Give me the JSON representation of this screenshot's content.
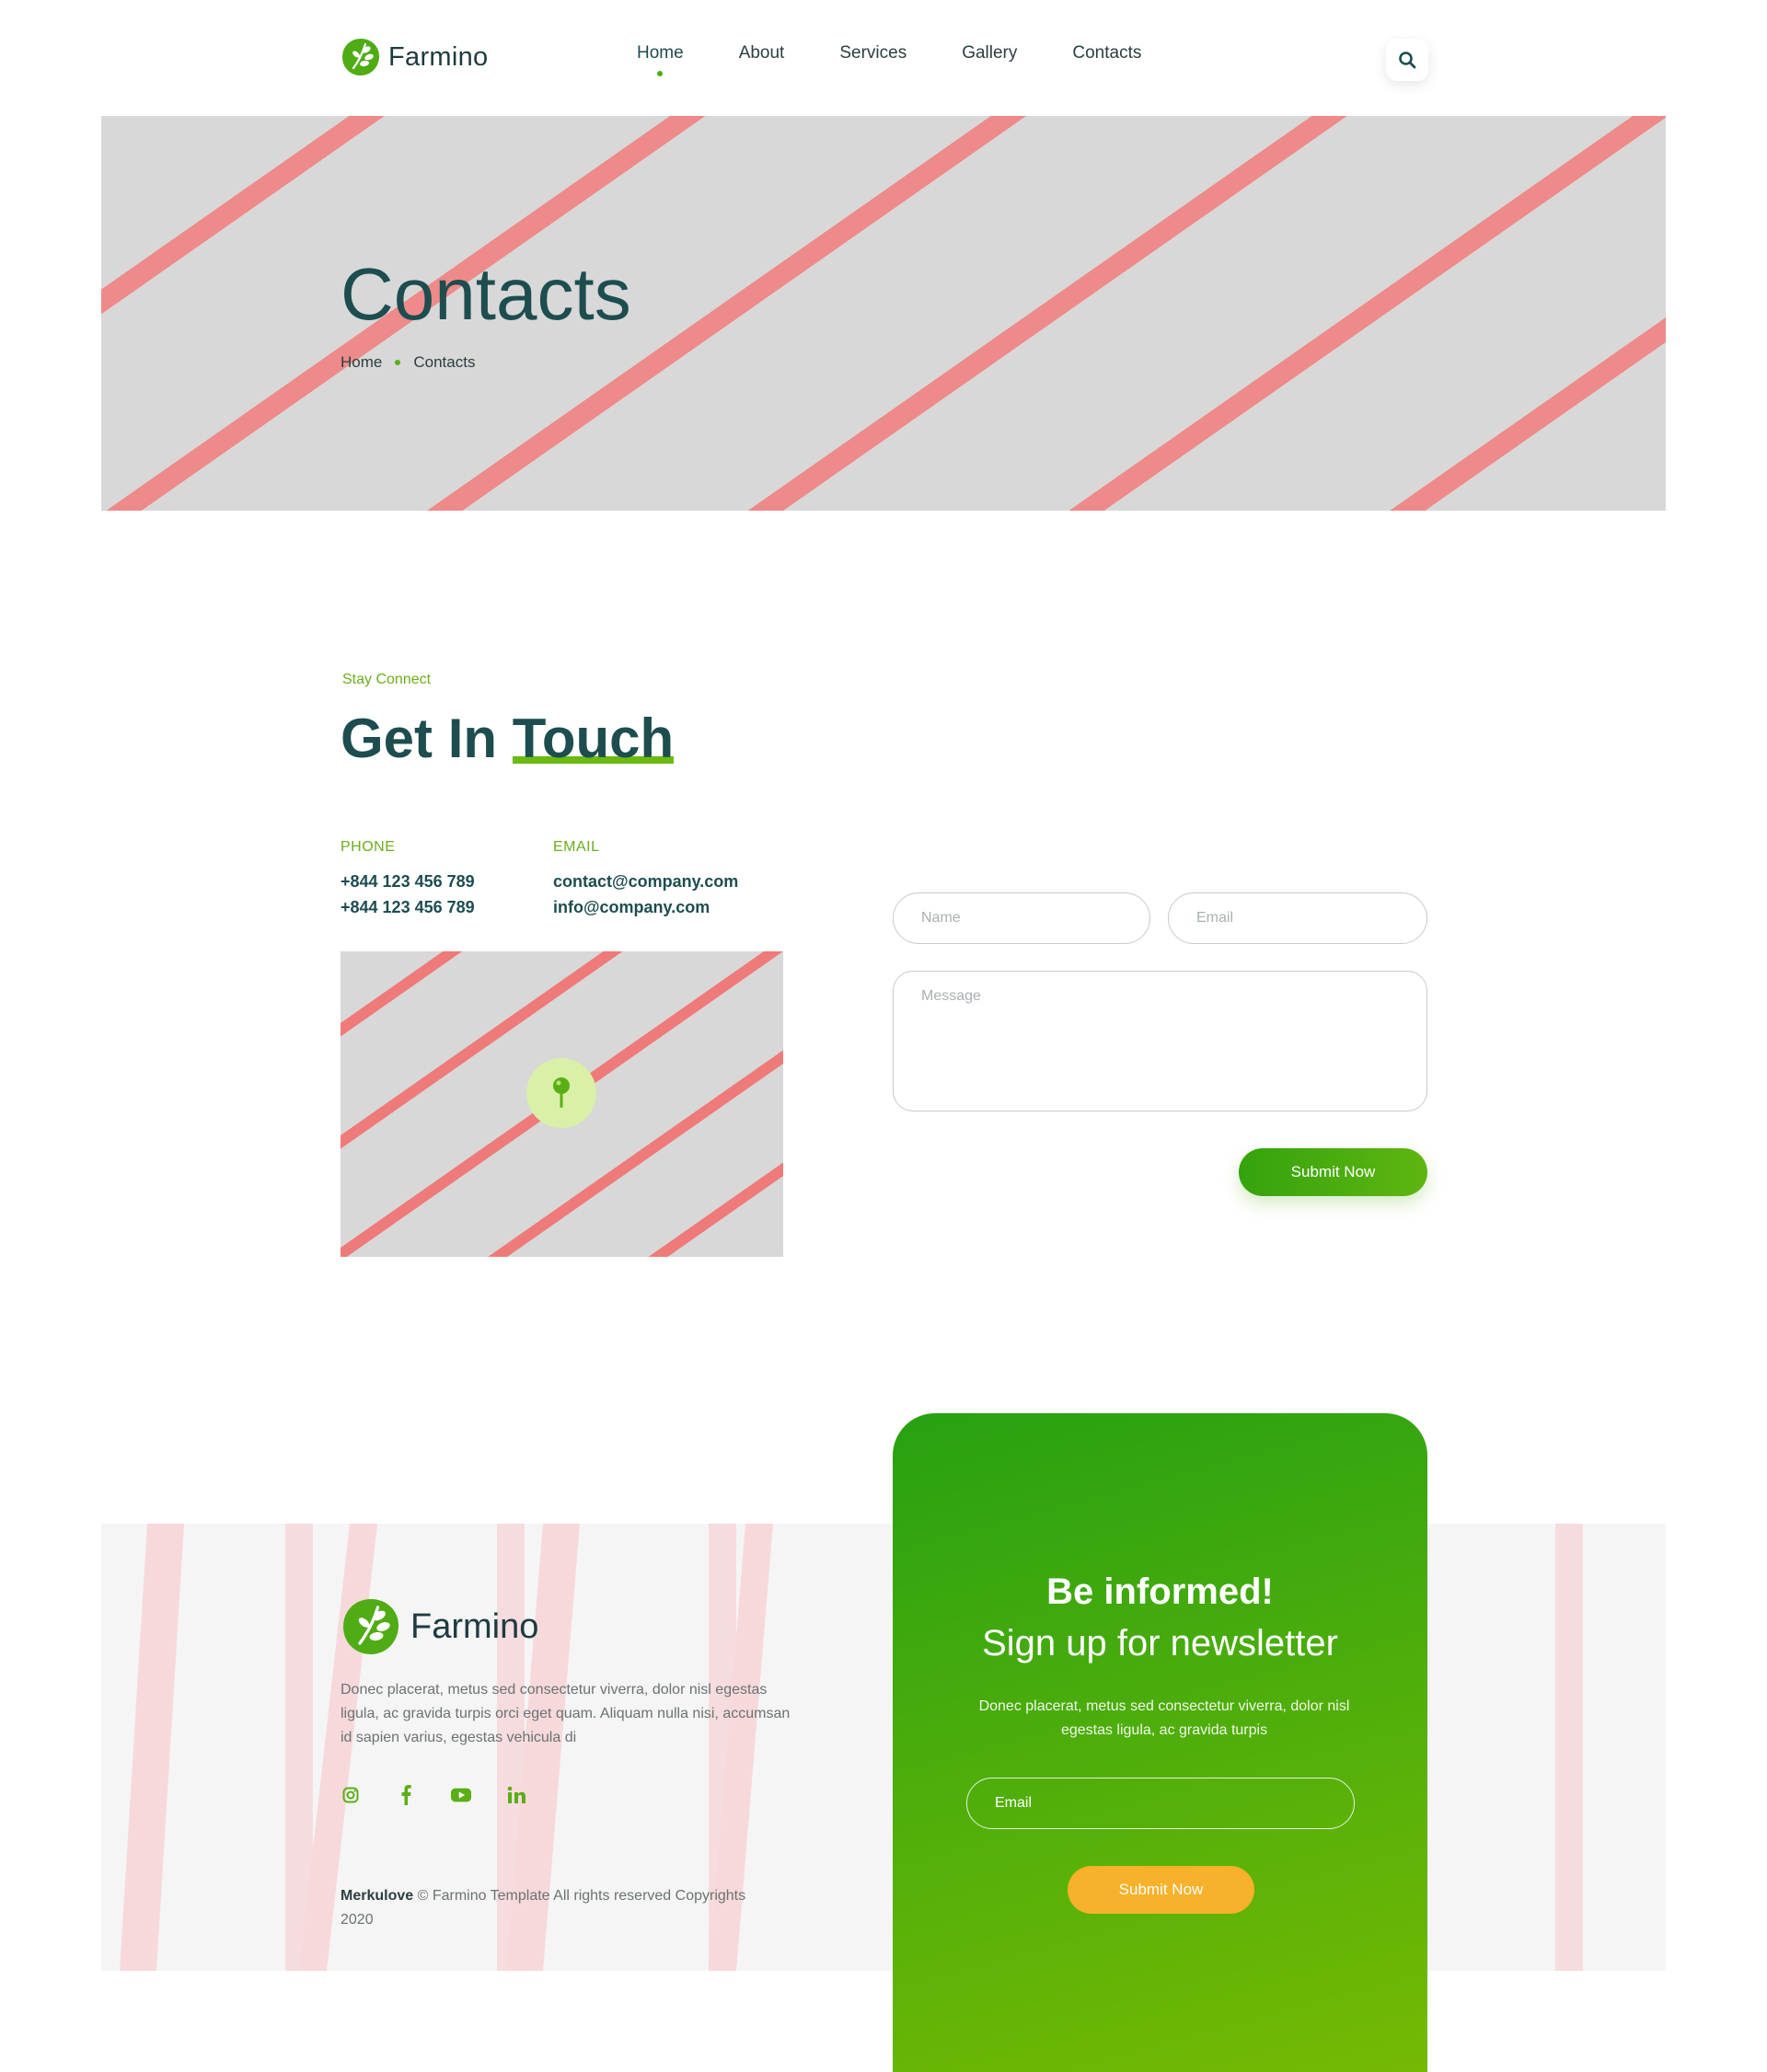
{
  "brand": {
    "name": "Farmino",
    "accent": "#5aaf15",
    "dark": "#1d4d4f",
    "orange": "#f7b12a"
  },
  "nav": {
    "items": [
      {
        "label": "Home",
        "active": true
      },
      {
        "label": "About",
        "active": false
      },
      {
        "label": "Services",
        "active": false
      },
      {
        "label": "Gallery",
        "active": false
      },
      {
        "label": "Contacts",
        "active": false
      }
    ],
    "search_icon": "search-icon"
  },
  "banner": {
    "title": "Contacts",
    "breadcrumb": [
      "Home",
      "Contacts"
    ]
  },
  "contact": {
    "eyebrow": "Stay Connect",
    "title_part1": "Get In",
    "title_part2": "Touch",
    "phone_label": "PHONE",
    "phones": [
      "+844 123 456 789",
      "+844 123 456 789"
    ],
    "email_label": "EMAIL",
    "emails": [
      "contact@company.com",
      "info@company.com"
    ],
    "map_icon": "map-pin-icon"
  },
  "form": {
    "name_placeholder": "Name",
    "email_placeholder": "Email",
    "message_placeholder": "Message",
    "submit_label": "Submit Now"
  },
  "footer": {
    "logo_text": "Farmino",
    "description": "Donec placerat, metus sed consectetur viverra, dolor nisl egestas ligula, ac gravida turpis orci eget quam. Aliquam nulla nisi, accumsan id sapien varius, egestas vehicula di",
    "socials": [
      "instagram-icon",
      "facebook-icon",
      "youtube-icon",
      "linkedin-icon"
    ],
    "copyright_author": "Merkulove",
    "copyright_text": " © Farmino Template All rights reserved Copyrights 2020"
  },
  "newsletter": {
    "title": "Be informed!",
    "subtitle": "Sign up for newsletter",
    "text": "Donec placerat, metus sed consectetur viverra, dolor nisl egestas ligula, ac gravida turpis",
    "email_placeholder": "Email",
    "submit_label": "Submit Now"
  }
}
